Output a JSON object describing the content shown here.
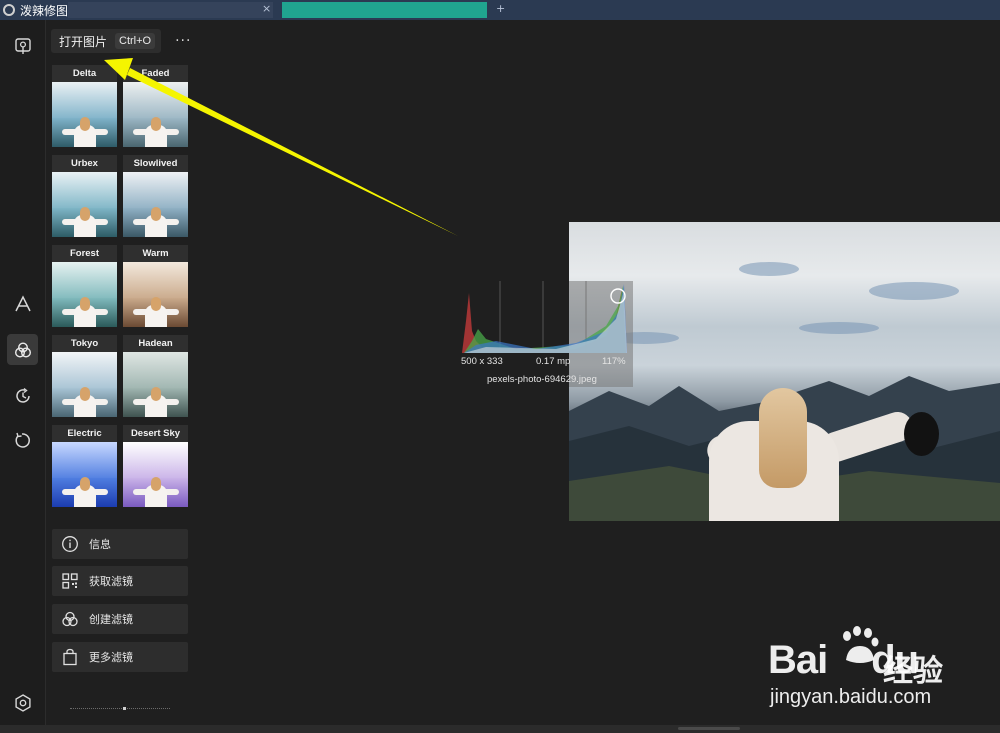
{
  "window": {
    "title": "泼辣修图"
  },
  "toolbar": {
    "open_label": "打开图片",
    "open_shortcut": "Ctrl+O",
    "more_label": "···"
  },
  "filters": [
    {
      "name": "Delta",
      "tint": "#7fb2c9",
      "sky": "#eaf1f4",
      "mtn": "#2e5b68"
    },
    {
      "name": "Faded",
      "tint": "#9bb6c4",
      "sky": "#edf0f0",
      "mtn": "#4a6670"
    },
    {
      "name": "Urbex",
      "tint": "#7eb5c6",
      "sky": "#e9f2f5",
      "mtn": "#2d5c66"
    },
    {
      "name": "Slowlived",
      "tint": "#8fb0c4",
      "sky": "#eef1f4",
      "mtn": "#3b5866"
    },
    {
      "name": "Forest",
      "tint": "#7fb9bc",
      "sky": "#e6f2f1",
      "mtn": "#2b5a5a"
    },
    {
      "name": "Warm",
      "tint": "#c9a98a",
      "sky": "#f3e9dd",
      "mtn": "#6b4a33"
    },
    {
      "name": "Tokyo",
      "tint": "#a7c3d4",
      "sky": "#f2f5f7",
      "mtn": "#4a6673"
    },
    {
      "name": "Hadean",
      "tint": "#9fb5b0",
      "sky": "#dfe6e3",
      "mtn": "#3f5350"
    },
    {
      "name": "Electric",
      "tint": "#4f7de0",
      "sky": "#c8d8ff",
      "mtn": "#1b3cb0"
    },
    {
      "name": "Desert Sky",
      "tint": "#c9b2e8",
      "sky": "#ffffff",
      "mtn": "#7a5ac0"
    }
  ],
  "menu": [
    {
      "label": "信息",
      "icon": "info-icon"
    },
    {
      "label": "获取滤镜",
      "icon": "qr-code-icon"
    },
    {
      "label": "创建滤镜",
      "icon": "filter-create-icon"
    },
    {
      "label": "更多滤镜",
      "icon": "shopping-bag-icon"
    }
  ],
  "rail": {
    "icons": [
      "open-image-icon",
      "text-icon",
      "filters-icon",
      "history-icon",
      "undo-icon",
      "settings-icon"
    ],
    "active": "filters-icon"
  },
  "image_info": {
    "dimensions": "500 x 333",
    "megapixels": "0.17 mp",
    "zoom": "117%",
    "filename": "pexels-photo-694629.jpeg"
  },
  "annotation": {
    "arrow_color": "#f5f500"
  },
  "watermark": {
    "logo": "Bai",
    "logo_suffix": "du",
    "cn": "经验",
    "url": "jingyan.baidu.com"
  },
  "colors": {
    "background": "#1f1f1f",
    "panel": "#2d2d2d",
    "titlebar": "#2b3a52"
  }
}
